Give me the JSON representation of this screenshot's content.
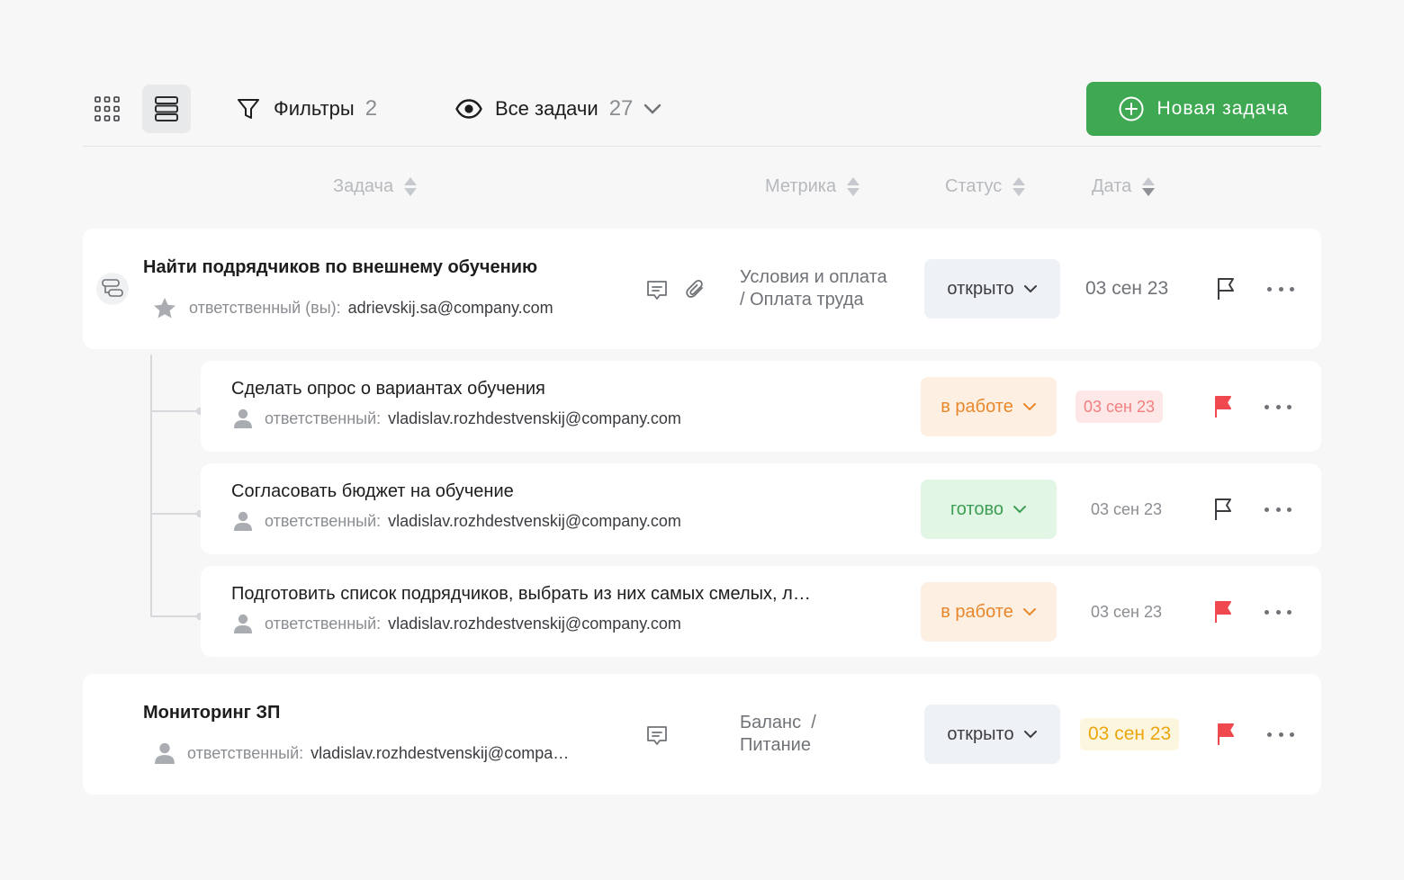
{
  "toolbar": {
    "filters_label": "Фильтры",
    "filters_count": "2",
    "view_label": "Все задачи",
    "view_count": "27",
    "new_task_label": "Новая задача",
    "accent_color": "#3ea853"
  },
  "columns": {
    "task": "Задача",
    "metric": "Метрика",
    "status": "Статус",
    "date": "Дата"
  },
  "tasks": [
    {
      "title": "Найти подрядчиков по внешнему обучению",
      "assignee_label": "ответственный (вы):",
      "assignee_email": "adrievskij.sa@company.com",
      "metric_line1": "Условия и оплата",
      "metric_line2": "/ Оплата труда",
      "status": "открыто",
      "date": "03 сен 23",
      "flagged": false,
      "starred": true,
      "has_subtasks": true,
      "icons": [
        "comment-icon",
        "attachment-icon"
      ]
    },
    {
      "title": "Мониторинг ЗП",
      "assignee_label": "ответственный:",
      "assignee_email": "vladislav.rozhdestvenskij@compa…",
      "metric_line1": "Баланс  /",
      "metric_line2": "Питание",
      "status": "открыто",
      "date": "03 сен 23",
      "date_color": "yellow",
      "flagged": true,
      "icons": [
        "comment-icon"
      ]
    }
  ],
  "subtasks": [
    {
      "title": "Сделать опрос о вариантах обучения",
      "assignee_label": "ответственный:",
      "assignee_email": "vladislav.rozhdestvenskij@company.com",
      "status": "в работе",
      "date": "03 сен 23",
      "date_color": "red",
      "flagged": true
    },
    {
      "title": "Согласовать бюджет на обучение",
      "assignee_label": "ответственный:",
      "assignee_email": "vladislav.rozhdestvenskij@company.com",
      "status": "готово",
      "date": "03 сен 23",
      "flagged": false
    },
    {
      "title": "Подготовить список подрядчиков, выбрать из них самых смелых, л…",
      "assignee_label": "ответственный:",
      "assignee_email": "vladislav.rozhdestvenskij@company.com",
      "status": "в работе",
      "date": "03 сен 23",
      "flagged": true
    }
  ],
  "colors": {
    "flag_red": "#f0484f",
    "status_work": "#e8872b",
    "status_done": "#3c9e53",
    "date_yellow": "#eba60f"
  }
}
